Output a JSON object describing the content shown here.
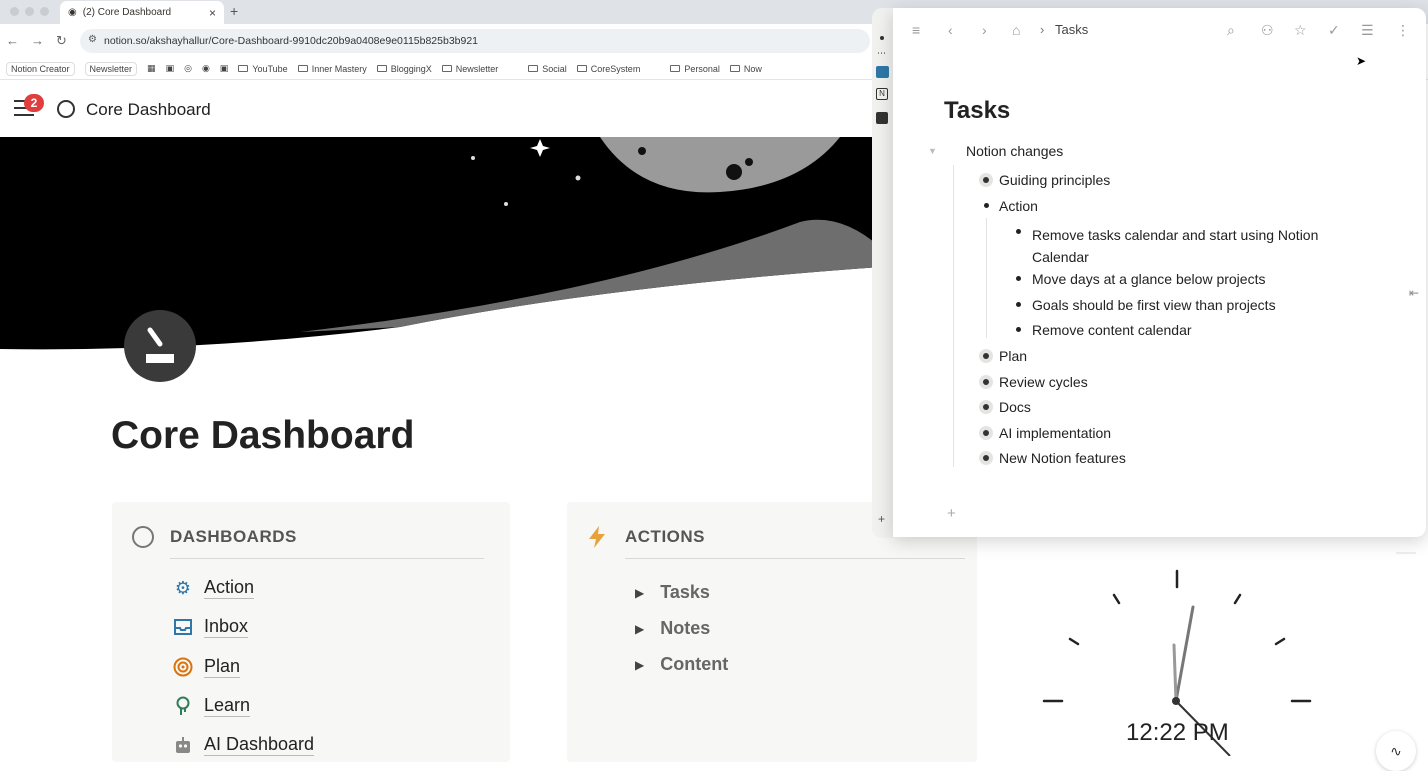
{
  "browser": {
    "tab_title": "(2) Core Dashboard",
    "url": "notion.so/akshayhallur/Core-Dashboard-9910dc20b9a0408e9e0115b825b3b921",
    "bookmarks": [
      "Notion Creator",
      "Newsletter",
      "YouTube",
      "Inner Mastery",
      "BloggingX",
      "Newsletter",
      "Social",
      "CoreSystem",
      "Personal",
      "Now"
    ]
  },
  "header": {
    "title": "Core Dashboard",
    "notification_count": "2"
  },
  "page": {
    "title": "Core Dashboard"
  },
  "dashboards": {
    "heading": "DASHBOARDS",
    "items": [
      {
        "label": "Action",
        "icon": "gear-icon",
        "color": "#2e77a8"
      },
      {
        "label": "Inbox",
        "icon": "inbox-icon",
        "color": "#2e77a8"
      },
      {
        "label": "Plan",
        "icon": "target-icon",
        "color": "#d9730d"
      },
      {
        "label": "Learn",
        "icon": "brain-icon",
        "color": "#2f7d5a"
      },
      {
        "label": "AI Dashboard",
        "icon": "robot-icon",
        "color": "#888888"
      }
    ]
  },
  "actions": {
    "heading": "ACTIONS",
    "items": [
      "Tasks",
      "Notes",
      "Content"
    ]
  },
  "clock": {
    "time": "12:22 PM"
  },
  "panel": {
    "breadcrumb": "Tasks",
    "title": "Tasks",
    "root": "Notion changes",
    "items": {
      "guiding": "Guiding principles",
      "action": "Action",
      "action_children": [
        "Remove tasks calendar and start using Notion Calendar",
        "Move days at a glance below projects",
        "Goals should be first view than projects",
        "Remove content calendar"
      ],
      "plan": "Plan",
      "review": "Review cycles",
      "docs": "Docs",
      "ai": "AI implementation",
      "features": "New Notion features"
    }
  },
  "colors": {
    "accent_red": "#e03e3e",
    "actions_bolt": "#e8a23b"
  }
}
